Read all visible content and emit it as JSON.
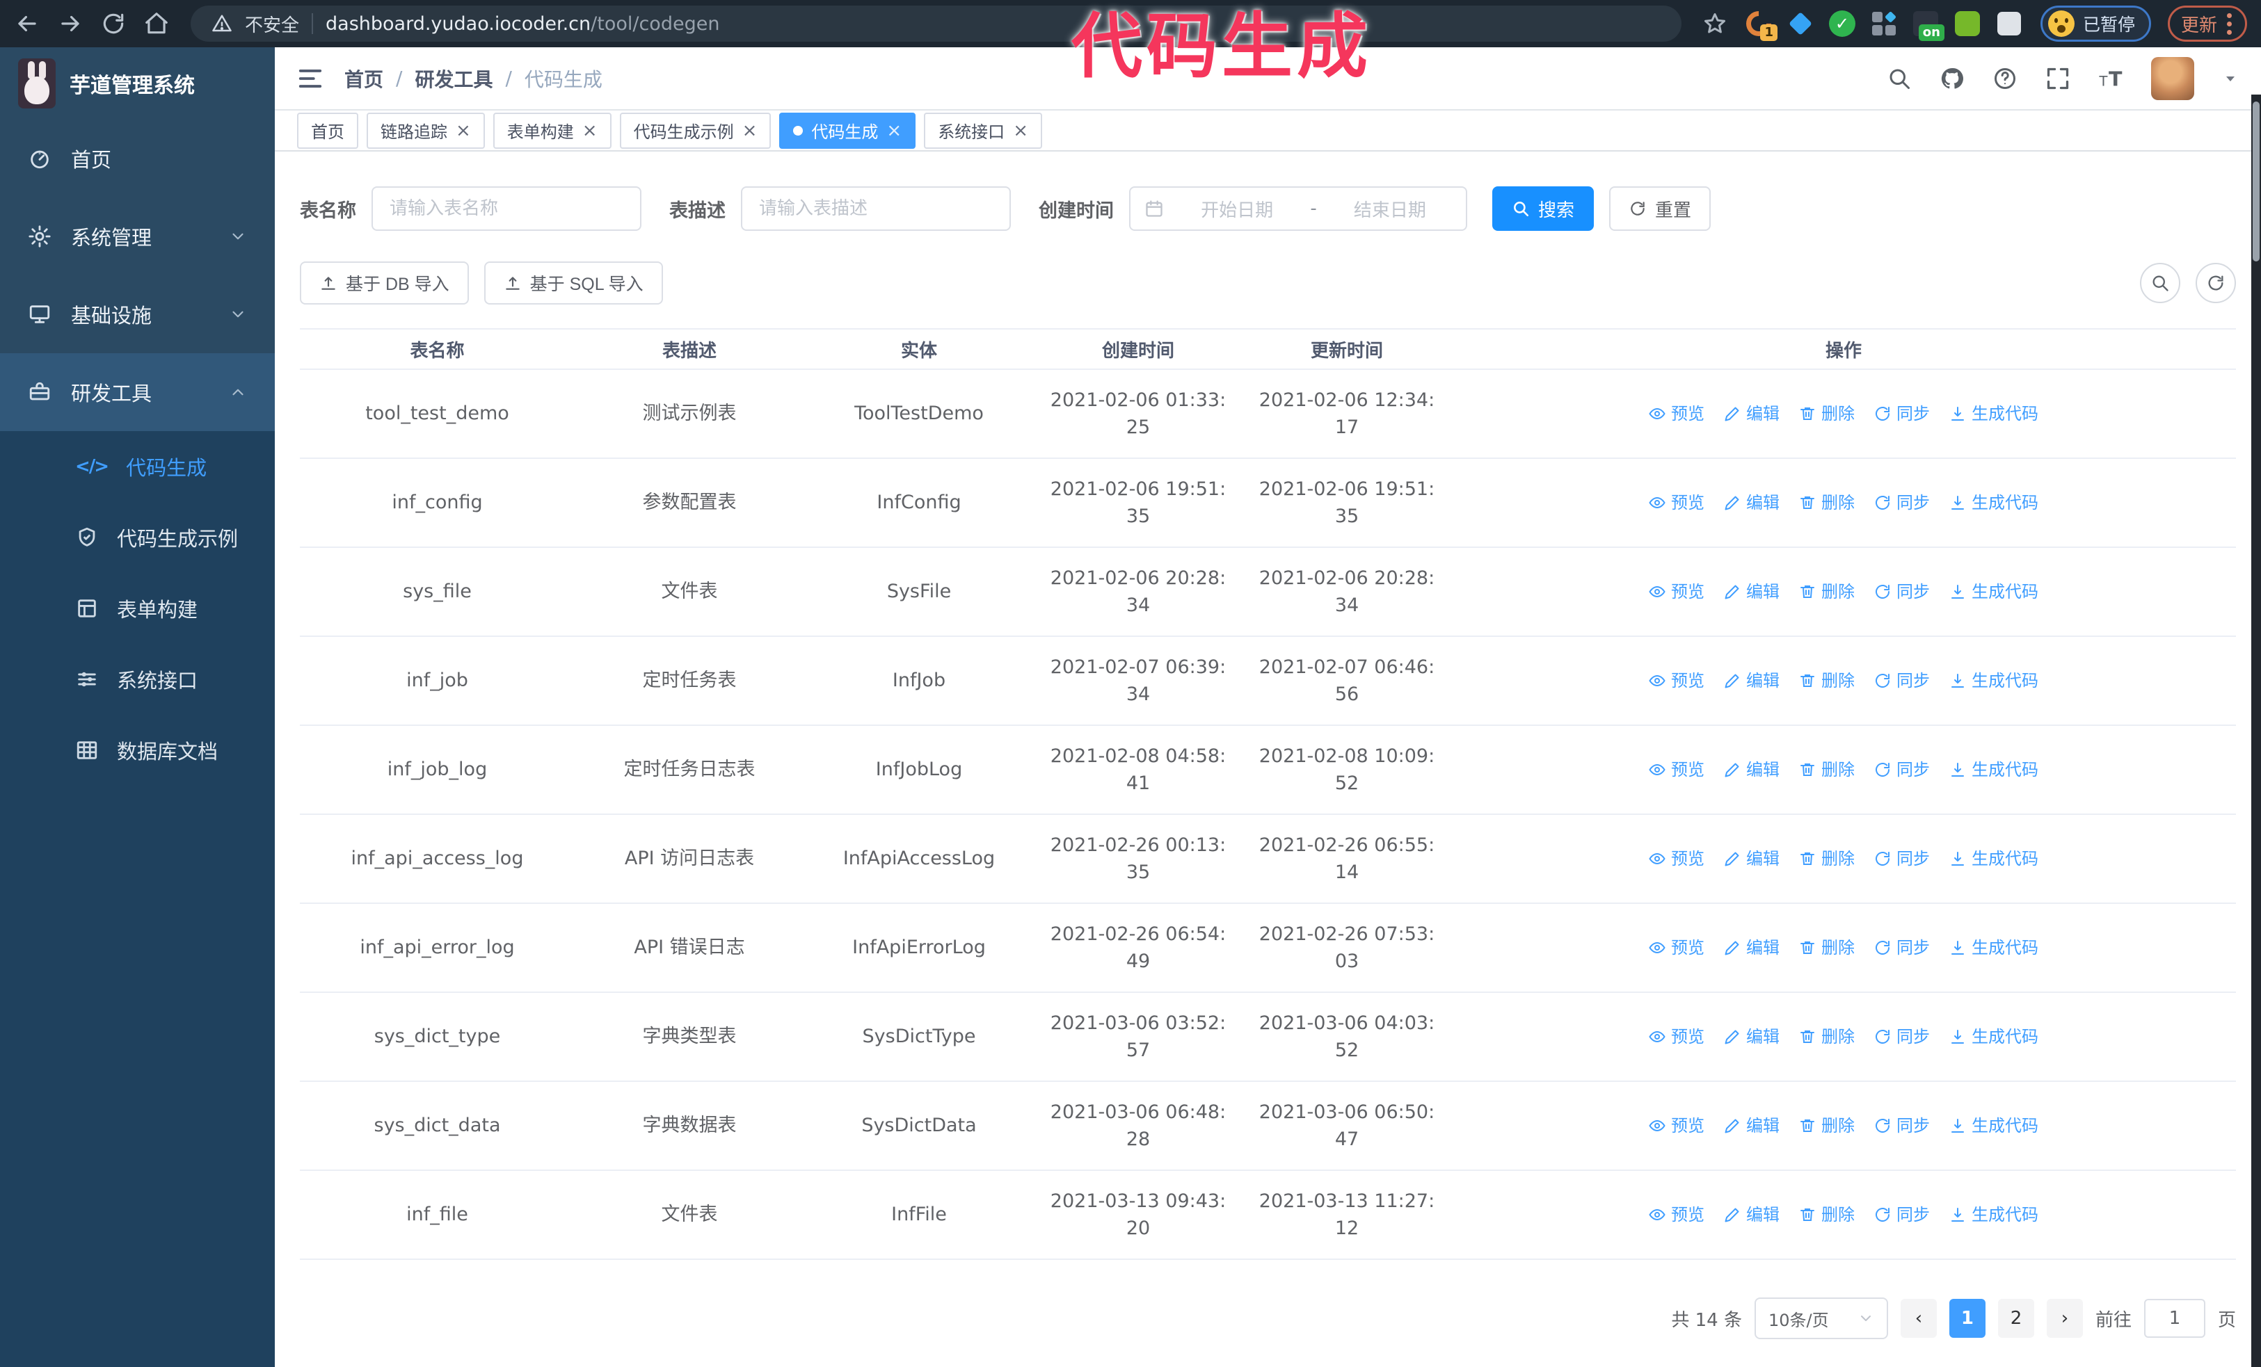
{
  "browser": {
    "security_label": "不安全",
    "url_domain": "dashboard.yudao.iocoder.cn",
    "url_path": "/tool/codegen",
    "profile_chip": "已暂停",
    "update_button": "更新",
    "extension_badge_1": "1",
    "extension_badge_on": "on",
    "extension_check_glyph": "✓"
  },
  "annotation": {
    "text": "代码生成",
    "color": "#f5365c"
  },
  "sidebar": {
    "title": "芋道管理系统",
    "items": [
      {
        "label": "首页",
        "icon": "dashboard-icon"
      },
      {
        "label": "系统管理",
        "icon": "gear-icon",
        "expandable": true
      },
      {
        "label": "基础设施",
        "icon": "monitor-icon",
        "expandable": true
      },
      {
        "label": "研发工具",
        "icon": "toolbox-icon",
        "expandable": true,
        "expanded": true
      }
    ],
    "submenu": [
      {
        "label": "代码生成",
        "icon": "code-icon",
        "active": true
      },
      {
        "label": "代码生成示例",
        "icon": "shield-check-icon"
      },
      {
        "label": "表单构建",
        "icon": "form-icon"
      },
      {
        "label": "系统接口",
        "icon": "sliders-icon"
      },
      {
        "label": "数据库文档",
        "icon": "table-grid-icon"
      }
    ]
  },
  "header": {
    "breadcrumb": [
      "首页",
      "研发工具",
      "代码生成"
    ],
    "breadcrumb_separator": "/"
  },
  "tabs": [
    {
      "label": "首页",
      "closable": false,
      "active": false
    },
    {
      "label": "链路追踪",
      "closable": true,
      "active": false
    },
    {
      "label": "表单构建",
      "closable": true,
      "active": false
    },
    {
      "label": "代码生成示例",
      "closable": true,
      "active": false
    },
    {
      "label": "代码生成",
      "closable": true,
      "active": true
    },
    {
      "label": "系统接口",
      "closable": true,
      "active": false
    }
  ],
  "ui": {
    "close_glyph": "×",
    "caret_glyph": "▾",
    "prev_glyph": "‹",
    "next_glyph": "›"
  },
  "filters": {
    "table_name_label": "表名称",
    "table_name_placeholder": "请输入表名称",
    "table_desc_label": "表描述",
    "table_desc_placeholder": "请输入表描述",
    "create_time_label": "创建时间",
    "start_date_placeholder": "开始日期",
    "range_separator": "-",
    "end_date_placeholder": "结束日期",
    "search_button": "搜索",
    "reset_button": "重置"
  },
  "toolbar": {
    "import_db_button": "基于 DB 导入",
    "import_sql_button": "基于 SQL 导入"
  },
  "table": {
    "columns": [
      "表名称",
      "表描述",
      "实体",
      "创建时间",
      "更新时间",
      "操作"
    ],
    "actions": [
      {
        "label": "预览",
        "icon": "eye-icon",
        "name": "preview-link"
      },
      {
        "label": "编辑",
        "icon": "edit-icon",
        "name": "edit-link"
      },
      {
        "label": "删除",
        "icon": "trash-icon",
        "name": "delete-link"
      },
      {
        "label": "同步",
        "icon": "sync-icon",
        "name": "sync-link"
      },
      {
        "label": "生成代码",
        "icon": "download-icon",
        "name": "generate-code-link"
      }
    ],
    "rows": [
      {
        "name": "tool_test_demo",
        "desc": "测试示例表",
        "entity": "ToolTestDemo",
        "created": "2021-02-06 01:33:25",
        "updated": "2021-02-06 12:34:17"
      },
      {
        "name": "inf_config",
        "desc": "参数配置表",
        "entity": "InfConfig",
        "created": "2021-02-06 19:51:35",
        "updated": "2021-02-06 19:51:35"
      },
      {
        "name": "sys_file",
        "desc": "文件表",
        "entity": "SysFile",
        "created": "2021-02-06 20:28:34",
        "updated": "2021-02-06 20:28:34"
      },
      {
        "name": "inf_job",
        "desc": "定时任务表",
        "entity": "InfJob",
        "created": "2021-02-07 06:39:34",
        "updated": "2021-02-07 06:46:56"
      },
      {
        "name": "inf_job_log",
        "desc": "定时任务日志表",
        "entity": "InfJobLog",
        "created": "2021-02-08 04:58:41",
        "updated": "2021-02-08 10:09:52"
      },
      {
        "name": "inf_api_access_log",
        "desc": "API 访问日志表",
        "entity": "InfApiAccessLog",
        "created": "2021-02-26 00:13:35",
        "updated": "2021-02-26 06:55:14"
      },
      {
        "name": "inf_api_error_log",
        "desc": "API 错误日志",
        "entity": "InfApiErrorLog",
        "created": "2021-02-26 06:54:49",
        "updated": "2021-02-26 07:53:03"
      },
      {
        "name": "sys_dict_type",
        "desc": "字典类型表",
        "entity": "SysDictType",
        "created": "2021-03-06 03:52:57",
        "updated": "2021-03-06 04:03:52"
      },
      {
        "name": "sys_dict_data",
        "desc": "字典数据表",
        "entity": "SysDictData",
        "created": "2021-03-06 06:48:28",
        "updated": "2021-03-06 06:50:47"
      },
      {
        "name": "inf_file",
        "desc": "文件表",
        "entity": "InfFile",
        "created": "2021-03-13 09:43:20",
        "updated": "2021-03-13 11:27:12"
      }
    ]
  },
  "pagination": {
    "total_text": "共 14 条",
    "page_size": "10条/页",
    "pages": [
      "1",
      "2"
    ],
    "current_page": "1",
    "goto_label": "前往",
    "goto_value": "1",
    "goto_suffix": "页"
  },
  "colors": {
    "accent": "#409eff",
    "search_button": "#1890ff",
    "sidebar_bg": "#2b4a63",
    "submenu_bg": "#1f415e",
    "sidebar_highlight": "#31587a",
    "chrome_bg": "#1d2731",
    "annotation": "#f5365c"
  }
}
